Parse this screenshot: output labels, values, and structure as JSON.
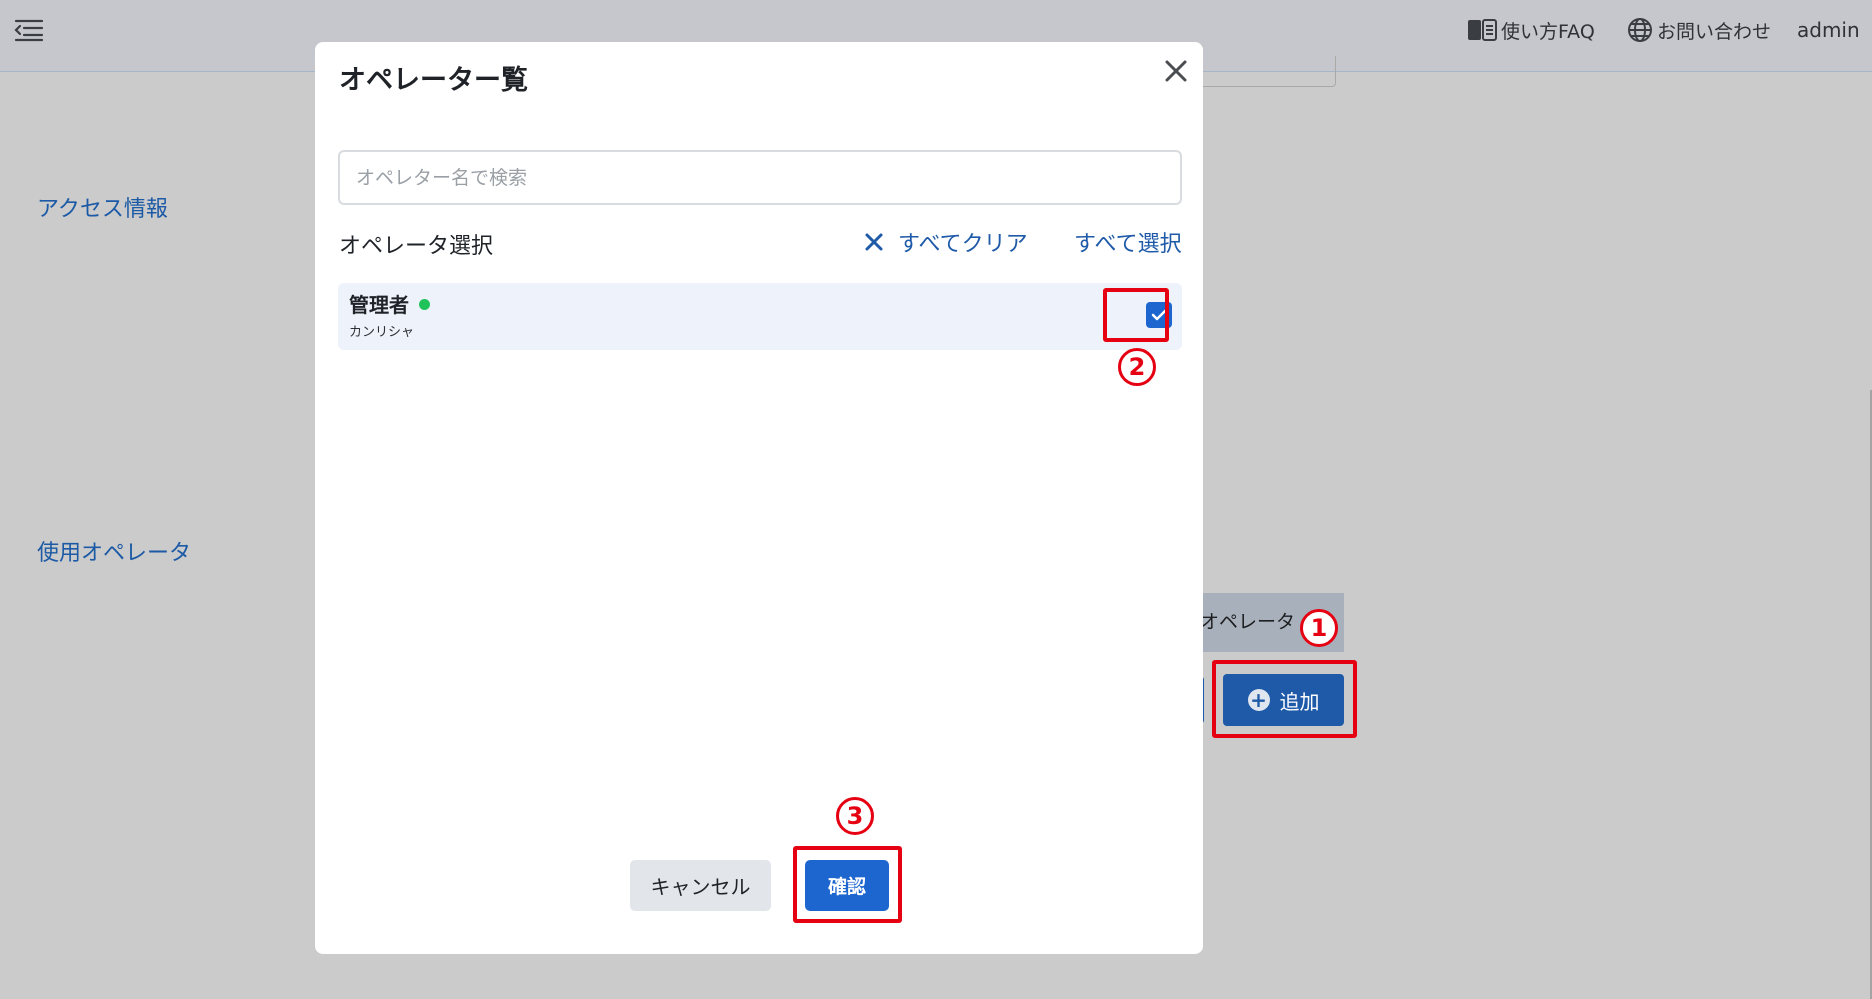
{
  "header": {
    "faq_label": "使い方FAQ",
    "contact_label": "お問い合わせ",
    "user": "admin"
  },
  "background": {
    "section_access": "アクセス情報",
    "section_operator": "使用オペレータ",
    "operator_tab": "オペレータ",
    "add_button": "追加"
  },
  "modal": {
    "title": "オペレーター覧",
    "search_placeholder": "オペレター名で検索",
    "selection_label": "オペレータ選択",
    "clear_all": "すべてクリア",
    "select_all": "すべて選択",
    "operators": [
      {
        "name": "管理者",
        "kana": "カンリシャ",
        "online": true,
        "checked": true
      }
    ],
    "cancel_label": "キャンセル",
    "confirm_label": "確認"
  },
  "annotations": [
    "1",
    "2",
    "3"
  ],
  "colors": {
    "accent": "#1e66cf",
    "link": "#1e5aa8",
    "annotation": "#e50012",
    "online": "#20c35a"
  }
}
